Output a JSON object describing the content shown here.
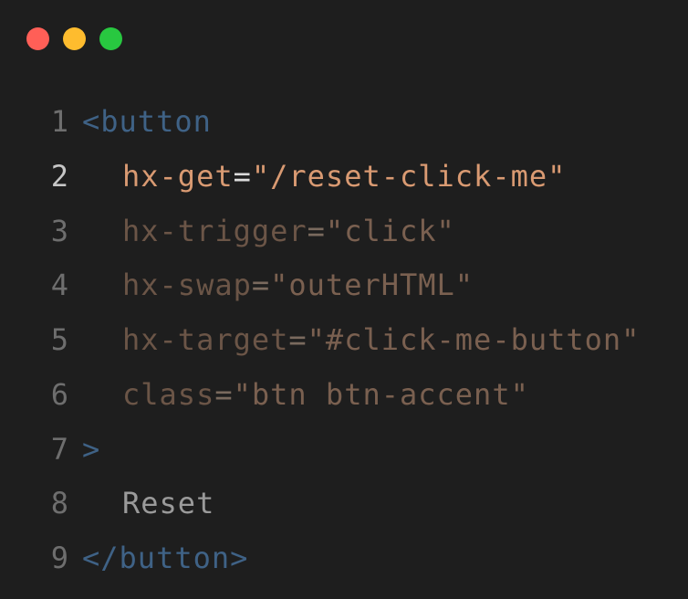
{
  "window": {
    "controls": {
      "close_color": "#ff5f57",
      "minimize_color": "#febc2e",
      "maximize_color": "#28c840"
    }
  },
  "colors": {
    "line_number": "#6e6e6e",
    "line_number_active": "#c6c6c6",
    "tag": "#3f6286",
    "attribute_dim": "#6b5547",
    "attribute_active": "#d99a72",
    "string_dim": "#7a6050",
    "string_active": "#d99a72",
    "punct_dim": "#7a6a5e",
    "punct_active": "#dcdcdc",
    "text": "#9a9a9a"
  },
  "editor": {
    "active_line": 2,
    "lines": [
      {
        "number": "1",
        "tokens": [
          {
            "text": "<button",
            "kind": "tag"
          }
        ]
      },
      {
        "number": "2",
        "indent": true,
        "tokens": [
          {
            "text": "hx-get",
            "kind": "attr"
          },
          {
            "text": "=",
            "kind": "punct"
          },
          {
            "text": "\"/reset-click-me\"",
            "kind": "string"
          }
        ]
      },
      {
        "number": "3",
        "indent": true,
        "tokens": [
          {
            "text": "hx-trigger",
            "kind": "attr"
          },
          {
            "text": "=",
            "kind": "punct"
          },
          {
            "text": "\"click\"",
            "kind": "string"
          }
        ]
      },
      {
        "number": "4",
        "indent": true,
        "tokens": [
          {
            "text": "hx-swap",
            "kind": "attr"
          },
          {
            "text": "=",
            "kind": "punct"
          },
          {
            "text": "\"outerHTML\"",
            "kind": "string"
          }
        ]
      },
      {
        "number": "5",
        "indent": true,
        "tokens": [
          {
            "text": "hx-target",
            "kind": "attr"
          },
          {
            "text": "=",
            "kind": "punct"
          },
          {
            "text": "\"#click-me-button\"",
            "kind": "string"
          }
        ]
      },
      {
        "number": "6",
        "indent": true,
        "tokens": [
          {
            "text": "class",
            "kind": "attr"
          },
          {
            "text": "=",
            "kind": "punct"
          },
          {
            "text": "\"btn btn-accent\"",
            "kind": "string"
          }
        ]
      },
      {
        "number": "7",
        "tokens": [
          {
            "text": ">",
            "kind": "tag"
          }
        ]
      },
      {
        "number": "8",
        "indent": true,
        "tokens": [
          {
            "text": "Reset",
            "kind": "text"
          }
        ]
      },
      {
        "number": "9",
        "tokens": [
          {
            "text": "</button>",
            "kind": "tag"
          }
        ]
      }
    ]
  }
}
